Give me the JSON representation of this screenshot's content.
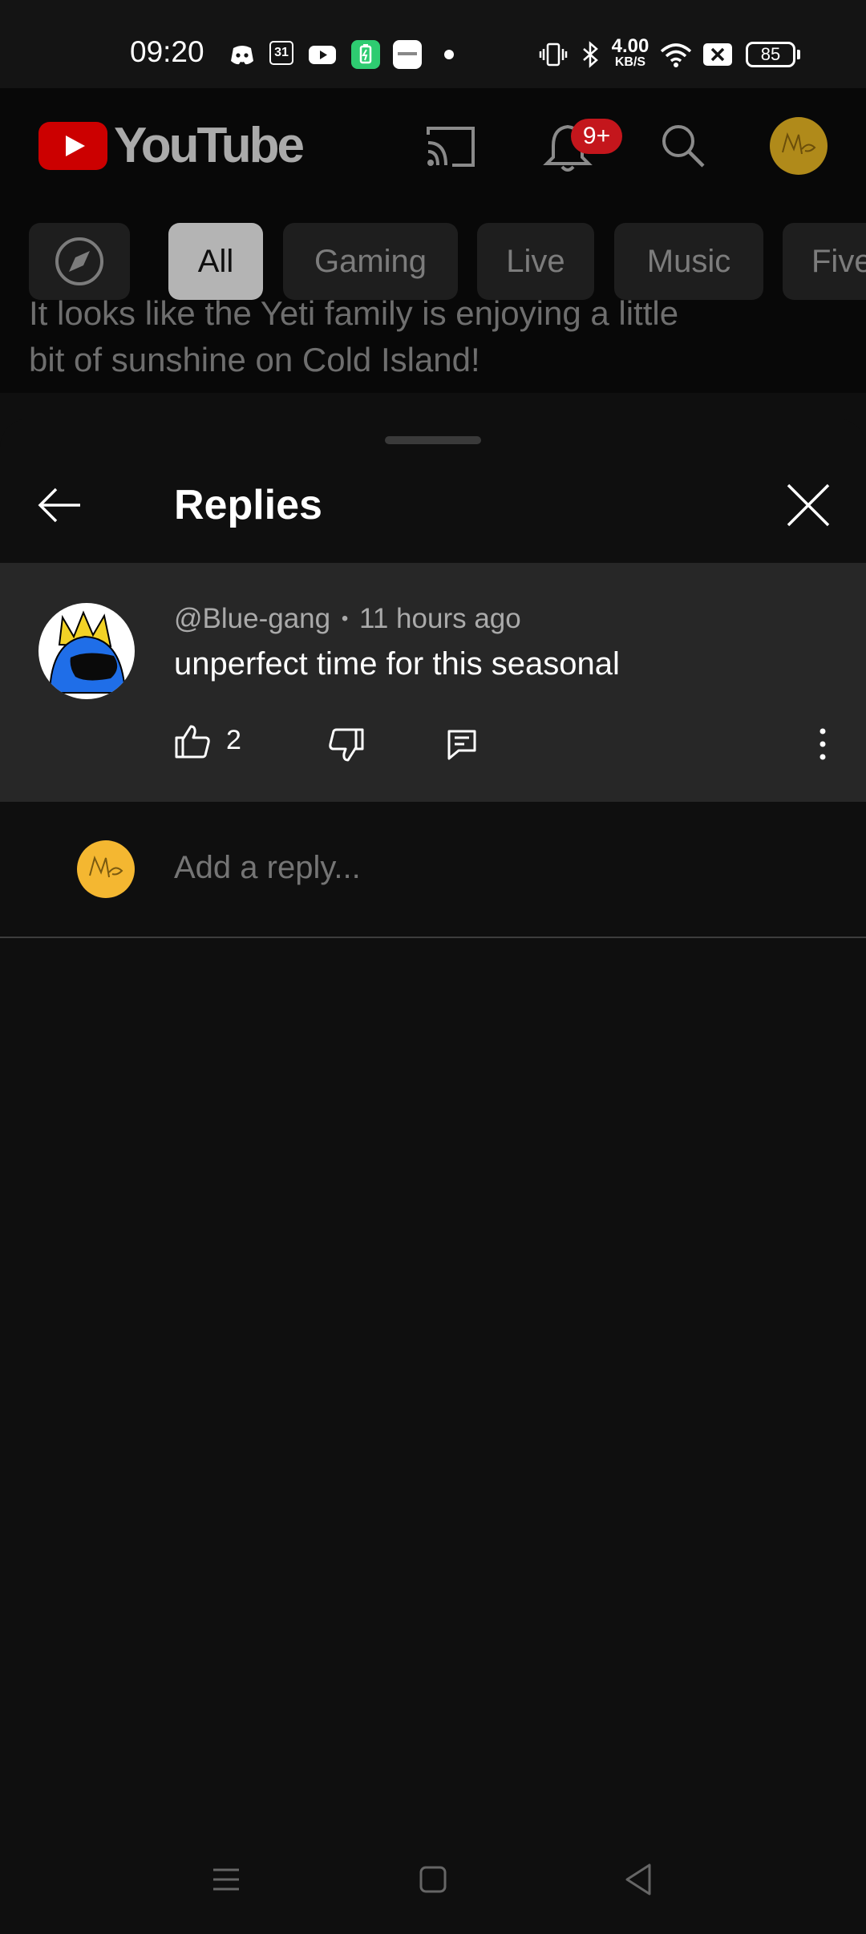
{
  "status_bar": {
    "time": "09:20",
    "calendar_day": "31",
    "net_speed_value": "4.00",
    "net_speed_unit": "KB/S",
    "battery_level": "85"
  },
  "app_bar": {
    "logo_text": "YouTube",
    "notification_badge": "9+"
  },
  "chips": [
    "All",
    "Gaming",
    "Live",
    "Music",
    "Five"
  ],
  "background_comment": {
    "line1": "It looks like the Yeti family is enjoying a little",
    "line2": "bit of sunshine on Cold Island!"
  },
  "sheet": {
    "title": "Replies"
  },
  "comment": {
    "author": "@Blue-gang",
    "separator": "•",
    "time": "11 hours ago",
    "text": "unperfect time for this seasonal",
    "like_count": "2"
  },
  "reply_box": {
    "placeholder": "Add a reply..."
  },
  "colors": {
    "background": "#0f0f0f",
    "comment_highlight": "#272727",
    "youtube_red": "#cc0000",
    "badge_red": "#c4161c",
    "chip_active": "#b4b4b4",
    "avatar_yellow": "#f4b731"
  }
}
